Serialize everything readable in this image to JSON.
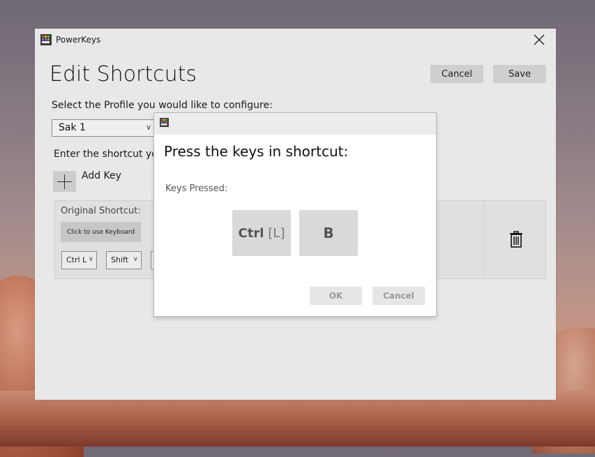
{
  "window": {
    "title": "PowerKeys",
    "close_icon": "close-icon"
  },
  "page": {
    "heading": "Edit Shortcuts",
    "cancel_label": "Cancel",
    "save_label": "Save",
    "profile_prompt": "Select the Profile you would like to configure:",
    "profile_value": "Sak 1",
    "shortcut_prompt": "Enter the shortcut yo",
    "add_key_label": "Add Key"
  },
  "shortcut_row": {
    "original_label": "Original Shortcut:",
    "keyboard_button": "Click to use Keyboard",
    "key1": "Ctrl L",
    "key2": "Shift",
    "delete_icon": "trash-icon"
  },
  "dialog": {
    "heading": "Press the keys in shortcut:",
    "keys_pressed_label": "Keys Pressed:",
    "key1_main": "Ctrl",
    "key1_sub": "[L]",
    "key2": "B",
    "ok_label": "OK",
    "cancel_label": "Cancel"
  }
}
